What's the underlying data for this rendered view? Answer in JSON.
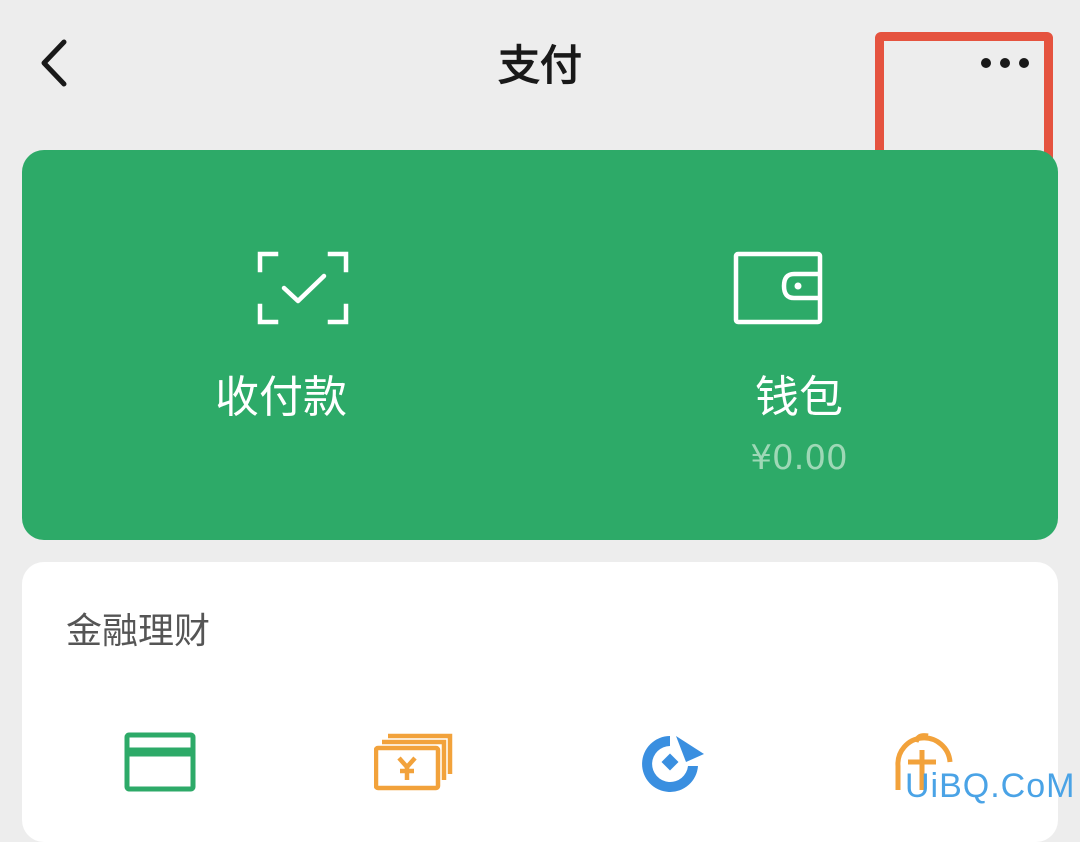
{
  "header": {
    "title": "支付",
    "back_icon": "chevron-left-icon",
    "more_icon": "ellipsis-icon"
  },
  "highlight_color": "#e5533f",
  "card": {
    "background": "#2daa68",
    "left": {
      "label": "收付款",
      "icon": "scan-check-icon"
    },
    "right": {
      "label": "钱包",
      "balance": "¥0.00",
      "icon": "wallet-icon"
    }
  },
  "finance": {
    "title": "金融理财",
    "icons": [
      {
        "name": "credit-card-icon",
        "color": "#2daa68"
      },
      {
        "name": "banknote-icon",
        "color": "#f2a23b"
      },
      {
        "name": "coin-swirl-icon",
        "color": "#3a8fe0"
      },
      {
        "name": "piggy-bank-icon",
        "color": "#f2a23b"
      }
    ]
  },
  "watermark": "UiBQ.CoM"
}
